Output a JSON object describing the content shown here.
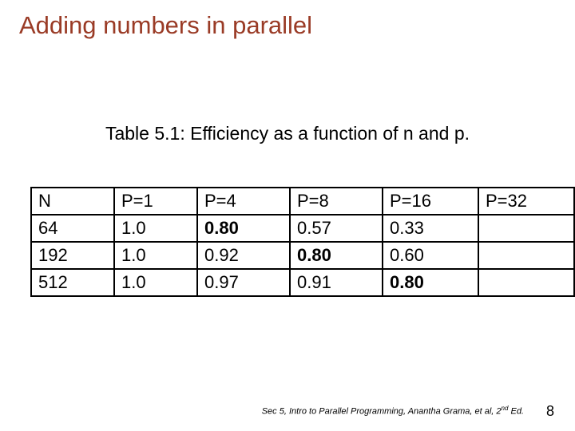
{
  "title": "Adding numbers in parallel",
  "caption": "Table 5.1: Efficiency as a function of n and p.",
  "chart_data": {
    "type": "table",
    "columns": [
      "N",
      "P=1",
      "P=4",
      "P=8",
      "P=16",
      "P=32"
    ],
    "rows": [
      {
        "n": "64",
        "p1": "1.0",
        "p4": "0.80",
        "p8": "0.57",
        "p16": "0.33",
        "p32": ""
      },
      {
        "n": "192",
        "p1": "1.0",
        "p4": "0.92",
        "p8": "0.80",
        "p16": "0.60",
        "p32": ""
      },
      {
        "n": "512",
        "p1": "1.0",
        "p4": "0.97",
        "p8": "0.91",
        "p16": "0.80",
        "p32": ""
      }
    ]
  },
  "footer": {
    "citation_prefix": "Sec 5, Intro to Parallel Programming, Anantha Grama, et al, 2",
    "citation_sup": "nd",
    "citation_suffix": " Ed."
  },
  "page_number": "8"
}
